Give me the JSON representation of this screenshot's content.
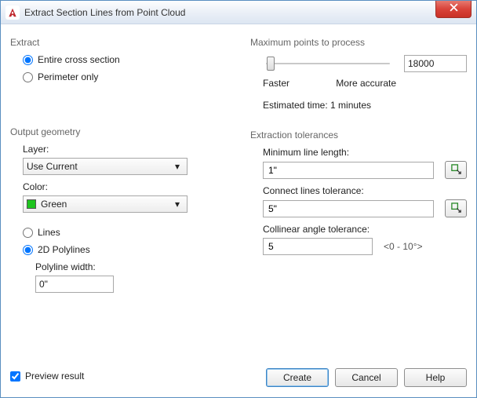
{
  "window": {
    "title": "Extract Section Lines from Point Cloud"
  },
  "extract": {
    "group": "Extract",
    "entire": "Entire cross section",
    "perimeter": "Perimeter only",
    "selected": "entire"
  },
  "maxpoints": {
    "group": "Maximum points to process",
    "value": "18000",
    "faster": "Faster",
    "accurate": "More accurate",
    "estimated": "Estimated time: 1 minutes",
    "slider_pos_pct": 3
  },
  "output": {
    "group": "Output geometry",
    "layer_label": "Layer:",
    "layer_value": "Use Current",
    "color_label": "Color:",
    "color_value": "Green",
    "color_hex": "#1ec41e",
    "lines": "Lines",
    "poly2d": "2D Polylines",
    "geom_selected": "poly2d",
    "polywidth_label": "Polyline width:",
    "polywidth_value": "0\""
  },
  "tolerances": {
    "group": "Extraction tolerances",
    "minlen_label": "Minimum line length:",
    "minlen_value": "1\"",
    "connect_label": "Connect lines tolerance:",
    "connect_value": "5\"",
    "collinear_label": "Collinear angle tolerance:",
    "collinear_value": "5",
    "collinear_hint": "<0 - 10°>"
  },
  "footer": {
    "preview": "Preview result",
    "preview_checked": true,
    "create": "Create",
    "cancel": "Cancel",
    "help": "Help"
  }
}
